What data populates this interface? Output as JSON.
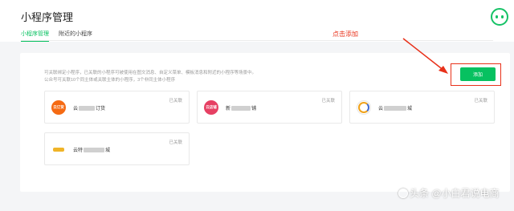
{
  "header": {
    "title": "小程序管理",
    "tabs": [
      {
        "label": "小程序管理",
        "active": true
      },
      {
        "label": "附近的小程序",
        "active": false
      }
    ]
  },
  "annotation": {
    "text": "点击添加",
    "color": "#e8311a"
  },
  "panel": {
    "description_line1": "可关联绑定小程序，已关联的小程序可被使用在图文消息、自定义菜单、模板消息和附近的小程序等场景中。",
    "description_line2": "公众号可关联10个同主体或关联主体的小程序，3个非同主体小程序",
    "add_button": "添加",
    "cards": [
      {
        "icon": "food-order-app-icon",
        "icon_text": "云订货",
        "name_prefix": "云",
        "name_suffix": "订货",
        "status": "已关联"
      },
      {
        "icon": "shop-app-icon",
        "icon_text": "云店铺",
        "name_prefix": "新",
        "name_suffix": "铺",
        "status": "已关联"
      },
      {
        "icon": "ring-logo-icon",
        "icon_text": "",
        "name_prefix": "云",
        "name_suffix": "城",
        "status": "已关联"
      },
      {
        "icon": "brand-logo-icon",
        "icon_text": "",
        "name_prefix": "云特",
        "name_suffix": "城",
        "status": "已关联"
      }
    ]
  },
  "watermark": "头条 @小白君说电商",
  "colors": {
    "brand": "#07c160",
    "annotation": "#e8311a"
  }
}
